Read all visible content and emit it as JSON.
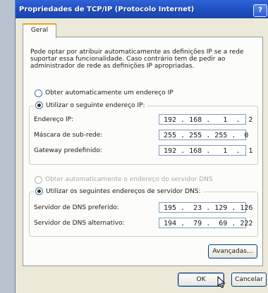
{
  "window": {
    "title": "Propriedades de TCP/IP (Protocolo Internet)",
    "help_label": "?"
  },
  "tabs": [
    {
      "label": "Geral",
      "selected": true
    }
  ],
  "description": "Pode optar por atribuir automaticamente as definições IP se a rede suportar essa funcionalidade. Caso contrário tem de pedir ao administrador de rede as definições IP apropriadas.",
  "ip": {
    "auto_label": "Obter automaticamente um endereço IP",
    "auto_selected": false,
    "manual_label": "Utilizar o seguinte endereço IP:",
    "manual_selected": true,
    "fields": [
      {
        "label": "Endereço IP:",
        "value": "192 . 168 .   1  .  2"
      },
      {
        "label": "Máscara de sub-rede:",
        "value": "255 . 255 . 255 .  0"
      },
      {
        "label": "Gateway predefinido:",
        "value": "192 . 168 .   1  .  1"
      }
    ]
  },
  "dns": {
    "auto_label": "Obter automaticamente o endereço do servidor DNS",
    "auto_selected": false,
    "auto_enabled": false,
    "manual_label": "Utilizar os seguintes endereços de servidor DNS:",
    "manual_selected": true,
    "fields": [
      {
        "label": "Servidor de DNS preferido:",
        "value": "195 .  23 . 129 . 126"
      },
      {
        "label": "Servidor de DNS alternativo:",
        "value": "194 .  79 .  69 . 222"
      }
    ]
  },
  "buttons": {
    "advanced": "Avançadas...",
    "ok": "OK",
    "cancel": "Cancelar"
  },
  "colors": {
    "title_bar": "#2058c8",
    "dialog_face": "#ece9d8",
    "tab_highlight": "#e7a624"
  }
}
